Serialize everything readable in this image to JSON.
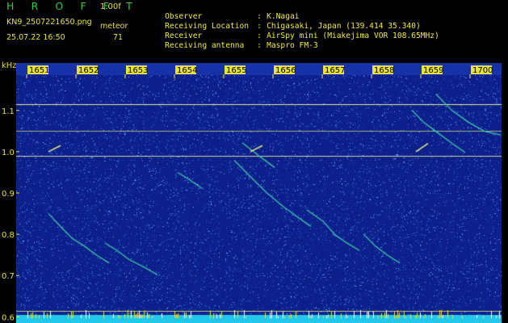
{
  "header": {
    "title": "H R O F F T",
    "version": "1.00f",
    "file_name": "KN9_2507221650.png",
    "timestamp": "25.07.22 16:50",
    "meteor_label": "meteor",
    "meteor_count": "71"
  },
  "info": [
    {
      "label": "Observer",
      "sep": ":",
      "value": "K.Nagai"
    },
    {
      "label": "Receiving Location",
      "sep": ":",
      "value": "Chigasaki, Japan (139.414 35.340)"
    },
    {
      "label": "Receiver",
      "sep": ":",
      "value": "AirSpy mini (Miakejima VOR 108.65MHz)"
    },
    {
      "label": "Receiving antenna",
      "sep": ":",
      "value": "Maspro FM-3"
    }
  ],
  "spectrogram": {
    "freq_unit": "kHz",
    "freq_ticks": [
      "1.1",
      "1.0",
      "0.9",
      "0.8",
      "0.7",
      "0.6"
    ],
    "freq_range": [
      0.585,
      1.215
    ],
    "time_ticks": [
      "1651",
      "1652",
      "1653",
      "1654",
      "1655",
      "1656",
      "1657",
      "1658",
      "1659",
      "1700"
    ],
    "colors": {
      "background": "#0c1f8a",
      "noise_high": "#3f7ef2",
      "trace": "#3cc8a4",
      "carrier_line": "#e8eb8a",
      "bottom_band": "#22c7ea",
      "label": "#e9e23a"
    }
  }
}
